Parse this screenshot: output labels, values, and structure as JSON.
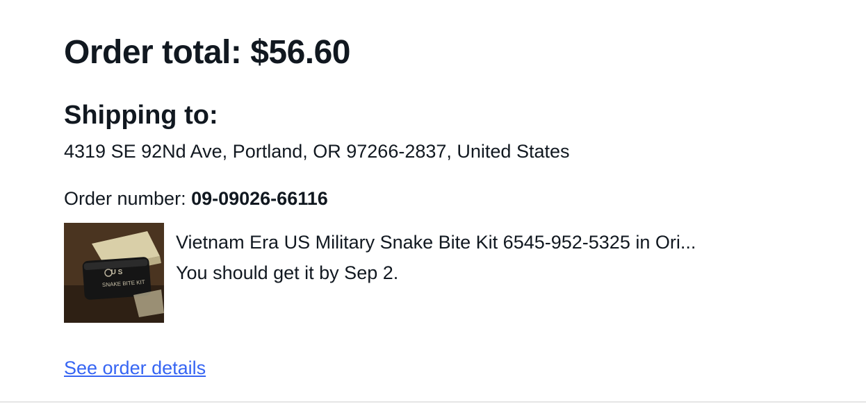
{
  "order": {
    "total_label": "Order total: $56.60",
    "shipping_heading": "Shipping to:",
    "address": "4319 SE 92Nd Ave, Portland, OR 97266-2837, United States",
    "order_number_label": "Order number: ",
    "order_number_value": "09-09026-66116"
  },
  "item": {
    "title": "Vietnam Era US Military Snake Bite Kit 6545-952-5325 in Ori...",
    "delivery_text": "You should get it by Sep 2.",
    "image_label_line1": "U S",
    "image_label_line2": "SNAKE BITE KIT"
  },
  "links": {
    "order_details": "See order details"
  },
  "colors": {
    "text": "#111820",
    "link": "#3665f3",
    "divider": "#e5e5e5"
  }
}
